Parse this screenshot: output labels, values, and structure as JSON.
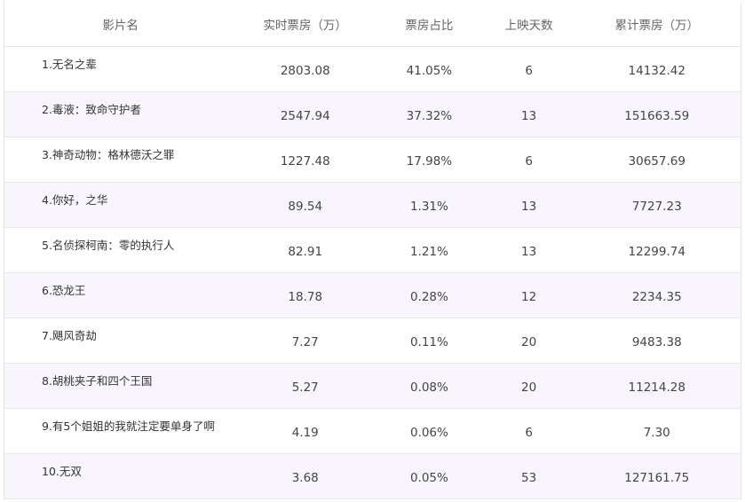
{
  "headers": [
    "影片名",
    "实时票房（万）",
    "票房占比",
    "上映天数",
    "累计票房（万）"
  ],
  "rows": [
    {
      "name": "1.无名之辈",
      "realtime": "2803.08",
      "share": "41.05%",
      "days": "6",
      "total": "14132.42"
    },
    {
      "name": "2.毒液：致命守护者",
      "realtime": "2547.94",
      "share": "37.32%",
      "days": "13",
      "total": "151663.59"
    },
    {
      "name": "3.神奇动物：格林德沃之罪",
      "realtime": "1227.48",
      "share": "17.98%",
      "days": "6",
      "total": "30657.69"
    },
    {
      "name": "4.你好，之华",
      "realtime": "89.54",
      "share": "1.31%",
      "days": "13",
      "total": "7727.23"
    },
    {
      "name": "5.名侦探柯南：零的执行人",
      "realtime": "82.91",
      "share": "1.21%",
      "days": "13",
      "total": "12299.74"
    },
    {
      "name": "6.恐龙王",
      "realtime": "18.78",
      "share": "0.28%",
      "days": "12",
      "total": "2234.35"
    },
    {
      "name": "7.飓风奇劫",
      "realtime": "7.27",
      "share": "0.11%",
      "days": "20",
      "total": "9483.38"
    },
    {
      "name": "8.胡桃夹子和四个王国",
      "realtime": "5.27",
      "share": "0.08%",
      "days": "20",
      "total": "11214.28"
    },
    {
      "name": "9.有5个姐姐的我就注定要单身了啊",
      "realtime": "4.19",
      "share": "0.06%",
      "days": "6",
      "total": "7.30"
    },
    {
      "name": "10.无双",
      "realtime": "3.68",
      "share": "0.05%",
      "days": "53",
      "total": "127161.75"
    }
  ]
}
